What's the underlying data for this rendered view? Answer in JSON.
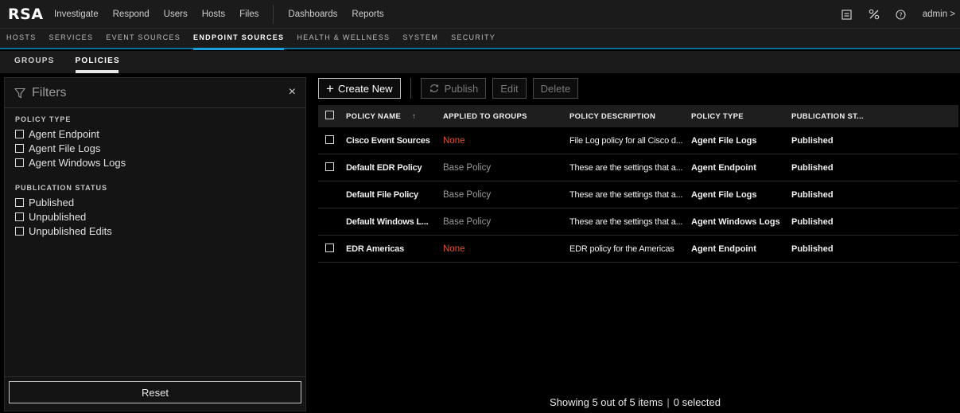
{
  "brand": "RSA",
  "topnav": {
    "items": [
      "Investigate",
      "Respond",
      "Users",
      "Hosts",
      "Files"
    ],
    "items2": [
      "Dashboards",
      "Reports"
    ],
    "user": "admin >"
  },
  "subnav": {
    "tabs": [
      "HOSTS",
      "SERVICES",
      "EVENT SOURCES",
      "ENDPOINT SOURCES",
      "HEALTH & WELLNESS",
      "SYSTEM",
      "SECURITY"
    ],
    "active": "ENDPOINT SOURCES"
  },
  "subtabs": {
    "tabs": [
      "GROUPS",
      "POLICIES"
    ],
    "active": "POLICIES"
  },
  "filters": {
    "title": "Filters",
    "close": "×",
    "policy_type": {
      "title": "POLICY TYPE",
      "options": [
        "Agent Endpoint",
        "Agent File Logs",
        "Agent Windows Logs"
      ]
    },
    "publication_status": {
      "title": "PUBLICATION STATUS",
      "options": [
        "Published",
        "Unpublished",
        "Unpublished Edits"
      ]
    },
    "reset_label": "Reset"
  },
  "toolbar": {
    "create_new": "Create New",
    "publish": "Publish",
    "edit": "Edit",
    "delete": "Delete"
  },
  "table": {
    "columns": [
      "POLICY NAME",
      "APPLIED TO GROUPS",
      "POLICY DESCRIPTION",
      "POLICY TYPE",
      "PUBLICATION ST..."
    ],
    "sort_indicator": "↑",
    "rows": [
      {
        "checkbox": true,
        "name": "Cisco Event Sources",
        "groups": "None",
        "description": "File Log policy for all Cisco d...",
        "type": "Agent File Logs",
        "status": "Published"
      },
      {
        "checkbox": true,
        "name": "Default EDR Policy",
        "groups": "Base Policy",
        "description": "These are the settings that a...",
        "type": "Agent Endpoint",
        "status": "Published"
      },
      {
        "checkbox": false,
        "name": "Default File Policy",
        "groups": "Base Policy",
        "description": "These are the settings that a...",
        "type": "Agent File Logs",
        "status": "Published"
      },
      {
        "checkbox": false,
        "name": "Default Windows L...",
        "groups": "Base Policy",
        "description": "These are the settings that a...",
        "type": "Agent Windows Logs",
        "status": "Published"
      },
      {
        "checkbox": true,
        "name": "EDR Americas",
        "groups": "None",
        "description": "EDR policy for the Americas",
        "type": "Agent Endpoint",
        "status": "Published"
      }
    ]
  },
  "status": {
    "showing": "Showing 5 out of 5 items",
    "separator": "|",
    "selected": "0 selected"
  },
  "colors": {
    "accent": "#1a9fd8",
    "none_red": "#e0512a",
    "background": "#000000",
    "panel": "#141414"
  }
}
